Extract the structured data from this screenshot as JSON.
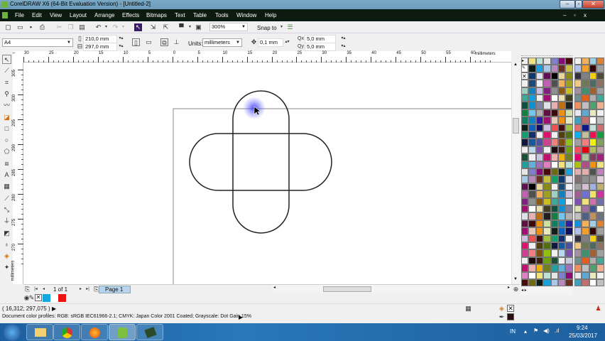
{
  "window": {
    "title": "CorelDRAW X6 (64-Bit Evaluation Version) - [Untitled-2]"
  },
  "menu": [
    "File",
    "Edit",
    "View",
    "Layout",
    "Arrange",
    "Effects",
    "Bitmaps",
    "Text",
    "Table",
    "Tools",
    "Window",
    "Help"
  ],
  "toolbar": {
    "zoom": "300%",
    "snap": "Snap to"
  },
  "propbar": {
    "page_size": "A4",
    "width": "210,0 mm",
    "height": "297,0 mm",
    "units_label": "Units:",
    "units": "millimeters",
    "nudge": "0,1 mm",
    "dup_x": "5,0 mm",
    "dup_y": "5,0 mm"
  },
  "ruler": {
    "h_ticks": [
      "30",
      "25",
      "20",
      "15",
      "10",
      "5",
      "0",
      "5",
      "10",
      "15",
      "20",
      "25",
      "30",
      "35",
      "40",
      "45",
      "50",
      "55",
      "60"
    ],
    "h_unit": "millimeters",
    "v_ticks": [
      "305",
      "300",
      "295",
      "290",
      "285",
      "280",
      "275",
      "270"
    ],
    "v_unit": "millimeters"
  },
  "pagenav": {
    "count": "1 of 1",
    "tab": "Page 1"
  },
  "status": {
    "coords": "( 16,312; 297,075 )",
    "profiles": "Document color profiles: RGB: sRGB IEC61966-2.1; CMYK: Japan Color 2001 Coated; Grayscale: Dot Gain 15%"
  },
  "tray": {
    "lang": "IN",
    "time": "9:24",
    "date": "25/03/2017"
  },
  "colors": {
    "fill": "#000000",
    "doc_palette": [
      "#13a8e0",
      "#ffffff",
      "#ee1111"
    ],
    "palette": [
      "#ffffff",
      "#f1e27a",
      "#bfe0d6",
      "#e6e6e6",
      "#7f7fcf",
      "#8a0a7a",
      "#4a0a0a",
      "#6f6a10",
      "#0e1a16",
      "#1aa0e0",
      "#a8c8e8",
      "#bb88bb",
      "#6a3020",
      "#c8c040",
      "#10a060",
      "#103870",
      "#e0e0f0",
      "#601050",
      "#000000",
      "#e8d8a0",
      "#8a8a10",
      "#f0f0f0",
      "#1a4a7a",
      "#f0f0f8",
      "#c060b0",
      "#505050",
      "#f0b060",
      "#a0a020",
      "#a0d0c0",
      "#1080c0",
      "#c8c0e0",
      "#802080",
      "#909090",
      "#8a5a10",
      "#c8c020",
      "#40a898",
      "#10a0e0",
      "#f0f0f0",
      "#a01070",
      "#ffffff",
      "#e8e0b0",
      "#404020",
      "#105040",
      "#1090d0",
      "#8080a0",
      "#e0e0e8",
      "#e8b0b0",
      "#c07010",
      "#202020",
      "#108040",
      "#70c8f0",
      "#b0b0b0",
      "#601040",
      "#400808",
      "#f09010",
      "#d0e0a0",
      "#108060",
      "#1080c0",
      "#3020a0",
      "#a01070",
      "#e8c8b8",
      "#f09010",
      "#e8e8c0",
      "#102018",
      "#1060c0",
      "#101060",
      "#d0c0e0",
      "#f05050",
      "#401010",
      "#a0c040",
      "#10a070",
      "#103070",
      "#f0f0f0",
      "#e01070",
      "#f0f0f0",
      "#504010",
      "#507010",
      "#101840",
      "#1858a0",
      "#5050a0",
      "#d04090",
      "#f08080",
      "#805010",
      "#90c010",
      "#f0f0f0",
      "#b8d8f0",
      "#8050b0",
      "#f0f0f0",
      "#200a10",
      "#402010",
      "#70a010",
      "#1a5038",
      "#f0f0f0",
      "#c8c8e0",
      "#c01070",
      "#f0b0b0",
      "#f0b010",
      "#708020",
      "#20a0a0",
      "#60b0e0",
      "#a070c0",
      "#e080c0"
    ],
    "palette2": [
      "#1090e0",
      "#f0b060",
      "#a0d0e8",
      "#e08030",
      "#b0c0e8",
      "#f0a030",
      "#300808",
      "#a0a0a0",
      "#303040",
      "#808080",
      "#f0d010",
      "#504838",
      "#f0c880",
      "#707858",
      "#506860",
      "#907060",
      "#a090a0",
      "#409070",
      "#a06030",
      "#a0a0a0",
      "#709090",
      "#e06020",
      "#b0b0b0",
      "#40a898",
      "#f09060",
      "#c0c0c0",
      "#50a070",
      "#f0b090",
      "#e8e8f0",
      "#60a8d0",
      "#e8e8c0",
      "#f0f0f0",
      "#40a0c0",
      "#c07070",
      "#ffffff",
      "#c0c0c0",
      "#e07070",
      "#101880",
      "#c0e0d8",
      "#d07070",
      "#10b0f0",
      "#c0c0a0",
      "#f01050",
      "#10a040",
      "#a0a0a0",
      "#f08080",
      "#f0f010",
      "#80a060",
      "#f05060",
      "#e00010",
      "#b0c060",
      "#c0a0a0",
      "#e00070",
      "#b0c0a0",
      "#804060",
      "#a02080",
      "#b0c010",
      "#b05080",
      "#f09010",
      "#f0e080",
      "#e0b0b0",
      "#e0b0b0",
      "#505050",
      "#c080c0",
      "#807070",
      "#909090",
      "#909090",
      "#e0d0e0",
      "#a0a0a0",
      "#d0c0d0",
      "#a0b0e0",
      "#c0b070",
      "#a06090",
      "#7070d0",
      "#f0e070",
      "#d030a0",
      "#8050b0",
      "#f0e080",
      "#d070b0",
      "#7070b0",
      "#e0e0b0",
      "#a070a0",
      "#405090",
      "#fffff0",
      "#c0c0c0",
      "#506080",
      "#c09060",
      "#707080"
    ]
  }
}
